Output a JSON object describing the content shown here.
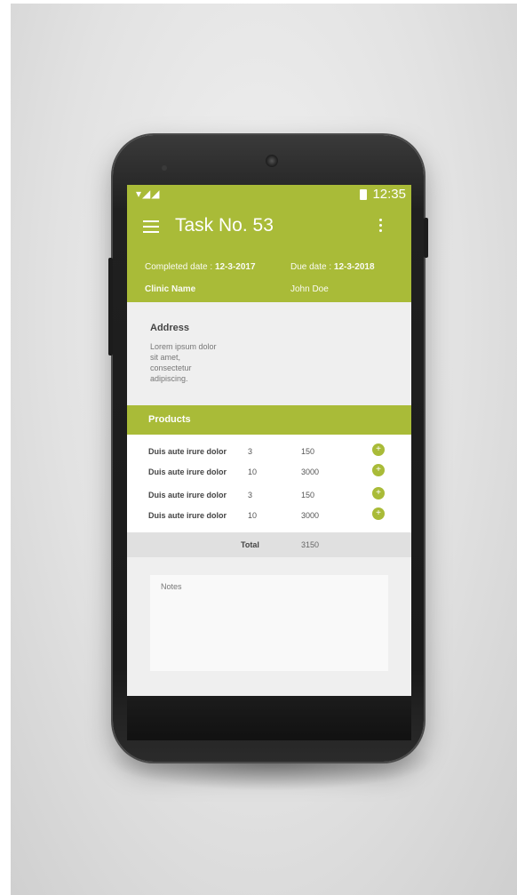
{
  "status_bar": {
    "time": "12:35"
  },
  "app_bar": {
    "title": "Task No. 53",
    "completed_label": "Completed date : ",
    "completed_date": "12-3-2017",
    "due_label": "Due date : ",
    "due_date": "12-3-2018",
    "clinic_name": "Clinic Name",
    "person": "John Doe"
  },
  "address": {
    "title": "Address",
    "text": "Lorem ipsum dolor sit amet, consectetur adipiscing."
  },
  "products": {
    "title": "Products",
    "rows": [
      {
        "name": "Duis aute irure dolor",
        "qty": "3",
        "price": "150",
        "add_label": "+"
      },
      {
        "name": "Duis aute irure dolor",
        "qty": "10",
        "price": "3000",
        "add_label": "+"
      },
      {
        "name": "Duis aute irure dolor",
        "qty": "3",
        "price": "150",
        "add_label": "+"
      },
      {
        "name": "Duis aute irure dolor",
        "qty": "10",
        "price": "3000",
        "add_label": "+"
      }
    ],
    "total_label": "Total",
    "total_value": "3150"
  },
  "notes": {
    "placeholder": "Notes"
  },
  "colors": {
    "accent": "#a9bb38",
    "background": "#efefef"
  },
  "icons": {
    "menu": "hamburger-icon",
    "more": "more-vert-icon",
    "add": "plus-icon"
  }
}
